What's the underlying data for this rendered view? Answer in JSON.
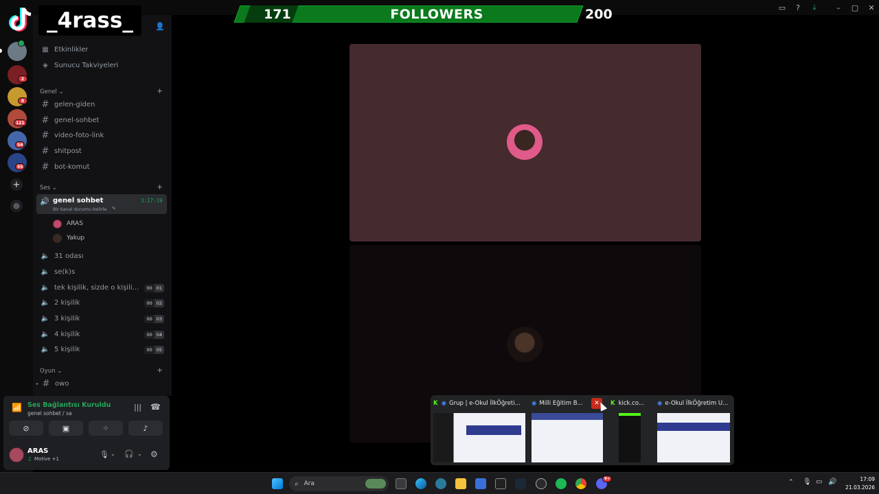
{
  "overlay": {
    "tiktok_name": "_4rass_",
    "followers_current": "171",
    "followers_label": "FOLLOWERS",
    "followers_goal": "200"
  },
  "rail": {
    "badges": [
      "2",
      "8",
      "121",
      "54",
      "55"
    ]
  },
  "sidebar": {
    "top_items": [
      {
        "label": "Etkinlikler"
      },
      {
        "label": "Sunucu Takviyeleri"
      }
    ],
    "categories": {
      "genel": "Genel",
      "ses": "Ses",
      "oyun": "Oyun"
    },
    "text_channels": [
      "gelen-giden",
      "genel-sohbet",
      "video-foto-link",
      "shitpost",
      "bot-komut"
    ],
    "active_voice": {
      "name": "genel sohbet",
      "timer": "3:17:19",
      "status": "Bir kanal durumu belirle",
      "members": [
        "ARAS",
        "Yakup"
      ]
    },
    "voice_channels": [
      {
        "name": "31 odası"
      },
      {
        "name": "se(k)s"
      },
      {
        "name": "tek kişilik, sizde o kişili...",
        "users": "00",
        "limit": "01"
      },
      {
        "name": "2 kişilik",
        "users": "00",
        "limit": "02"
      },
      {
        "name": "3 kişilik",
        "users": "00",
        "limit": "03"
      },
      {
        "name": "4 kişilik",
        "users": "00",
        "limit": "04"
      },
      {
        "name": "5 kişilik",
        "users": "00",
        "limit": "05"
      }
    ],
    "oyun_channels": [
      "owo"
    ]
  },
  "voice_panel": {
    "status": "Ses Bağlantısı Kuruldu",
    "channel": "genel sohbet / sa"
  },
  "user": {
    "name": "ARAS",
    "activity": "Motive +1"
  },
  "thumbs": [
    {
      "title": "Grup | e-Okul İlkÖğreti..."
    },
    {
      "title": "Milli Eğitim B..."
    },
    {
      "title": "kick.co..."
    },
    {
      "title": "e-Okul İlkÖğretim U..."
    }
  ],
  "taskbar": {
    "search_placeholder": "Ara",
    "time": "17:09",
    "date": "21.03.2026",
    "discord_badge": "9+"
  },
  "colors": {
    "accent_green": "#23a55a",
    "follower_bar": "#0a7a1c",
    "tile_bg": "#452a2e",
    "badge_red": "#da373c"
  }
}
